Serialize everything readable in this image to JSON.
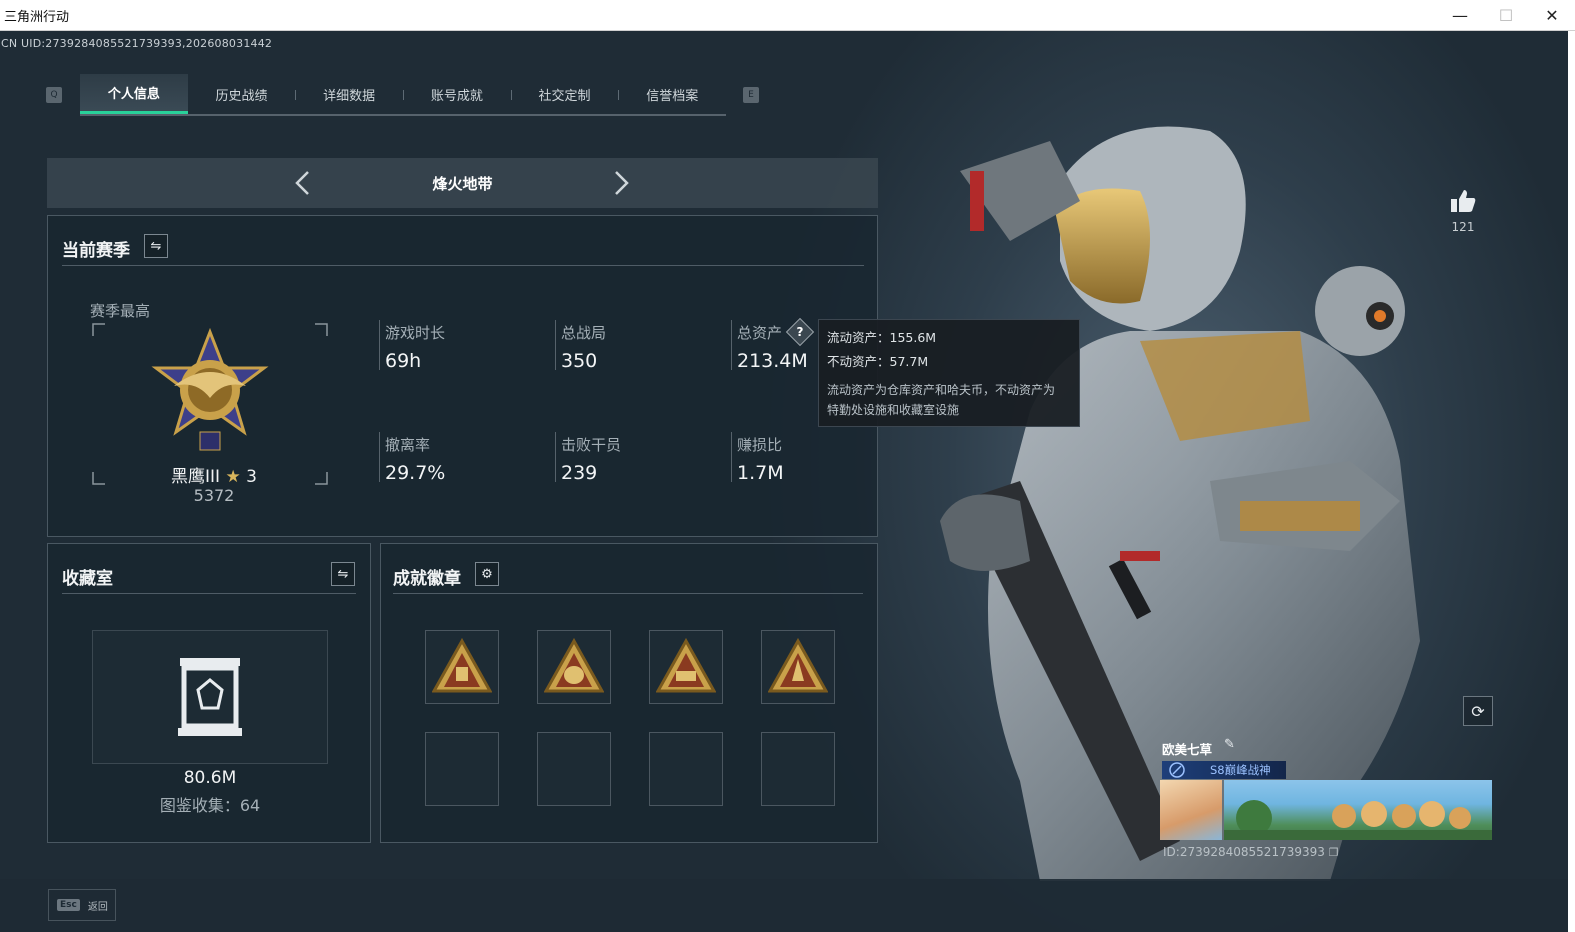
{
  "window": {
    "title": "三角洲行动",
    "minimize": "—",
    "maximize": "☐",
    "close": "✕"
  },
  "uid_line": "CN UID:2739284085521739393,202608031442",
  "tabs": [
    {
      "label": "个人信息",
      "active": true
    },
    {
      "label": "历史战绩",
      "active": false
    },
    {
      "label": "详细数据",
      "active": false
    },
    {
      "label": "账号成就",
      "active": false
    },
    {
      "label": "社交定制",
      "active": false
    },
    {
      "label": "信誉档案",
      "active": false
    }
  ],
  "keyhints": {
    "left": "Q",
    "right": "E"
  },
  "mode": {
    "name": "烽火地带"
  },
  "season": {
    "title": "当前赛季",
    "best_label": "赛季最高",
    "rank_name": "黑鹰III",
    "rank_star": "3",
    "rank_points": "5372",
    "stats": [
      {
        "label": "游戏时长",
        "value": "69h"
      },
      {
        "label": "总战局",
        "value": "350"
      },
      {
        "label": "总资产",
        "value": "213.4M"
      },
      {
        "label": "撤离率",
        "value": "29.7%"
      },
      {
        "label": "击败干员",
        "value": "239"
      },
      {
        "label": "赚损比",
        "value": "1.7M"
      }
    ]
  },
  "tooltip": {
    "liquid": "流动资产：155.6M",
    "fixed": "不动资产：57.7M",
    "desc1": "流动资产为仓库资产和哈夫币，不动资产为",
    "desc2": "特勤处设施和收藏室设施"
  },
  "collection": {
    "title": "收藏室",
    "value": "80.6M",
    "codex": "图鉴收集：64"
  },
  "achievements": {
    "title": "成就徽章",
    "badges": [
      "badge-1",
      "badge-55",
      "badge-56",
      "badge-4"
    ]
  },
  "like": {
    "count": "121"
  },
  "player": {
    "name": "欧美七草",
    "title_tag": "S8巅峰战神",
    "id_line": "ID:2739284085521739393"
  },
  "bottom": {
    "esc_key": "Esc",
    "esc_label": "返回"
  },
  "colors": {
    "accent": "#29d19a",
    "panel_border": "#4a5862",
    "gold": "#c9a14a"
  }
}
